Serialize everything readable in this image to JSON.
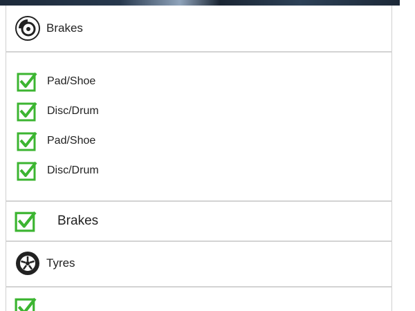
{
  "colors": {
    "check_green": "#3cb531",
    "divider": "#d3d3d3",
    "text": "#222222"
  },
  "sections": {
    "brakes_header": {
      "label": "Brakes",
      "icon": "brake-disc-icon"
    },
    "brake_items": [
      {
        "label": "Pad/Shoe",
        "checked": true
      },
      {
        "label": "Disc/Drum",
        "checked": true
      },
      {
        "label": "Pad/Shoe",
        "checked": true
      },
      {
        "label": "Disc/Drum",
        "checked": true
      }
    ],
    "brakes_checked": {
      "label": "Brakes",
      "checked": true
    },
    "tyres_header": {
      "label": "Tyres",
      "icon": "tyre-wheel-icon"
    },
    "tyres_checked": {
      "checked": true
    }
  }
}
